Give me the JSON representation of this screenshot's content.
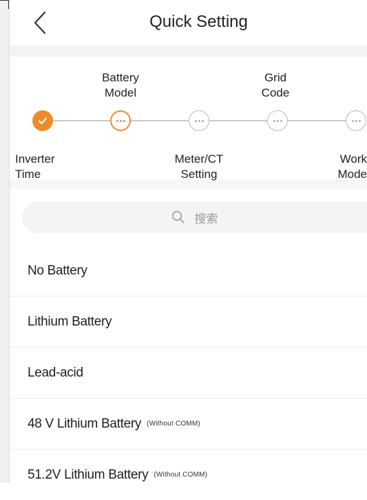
{
  "header": {
    "title": "Quick Setting"
  },
  "steps": [
    {
      "label": "Inverter\nTime",
      "state": "done",
      "position": "below"
    },
    {
      "label": "Battery\nModel",
      "state": "active",
      "position": "above"
    },
    {
      "label": "Meter/CT\nSetting",
      "state": "pending",
      "position": "below"
    },
    {
      "label": "Grid\nCode",
      "state": "pending",
      "position": "above"
    },
    {
      "label": "Work\nMode",
      "state": "pending",
      "position": "below"
    }
  ],
  "search": {
    "placeholder": "搜索"
  },
  "battery_options": [
    {
      "label": "No Battery",
      "note": ""
    },
    {
      "label": "Lithium Battery",
      "note": ""
    },
    {
      "label": "Lead-acid",
      "note": ""
    },
    {
      "label": "48 V Lithium Battery",
      "note": "(Without COMM)"
    },
    {
      "label": "51.2V Lithium Battery",
      "note": "(Without COMM)"
    }
  ],
  "colors": {
    "accent": "#ef8a2a",
    "pending": "#b9b9b9"
  },
  "icons": {
    "back": "chevron-left-icon",
    "search": "search-icon",
    "done": "check-icon",
    "more": "ellipsis-icon"
  }
}
